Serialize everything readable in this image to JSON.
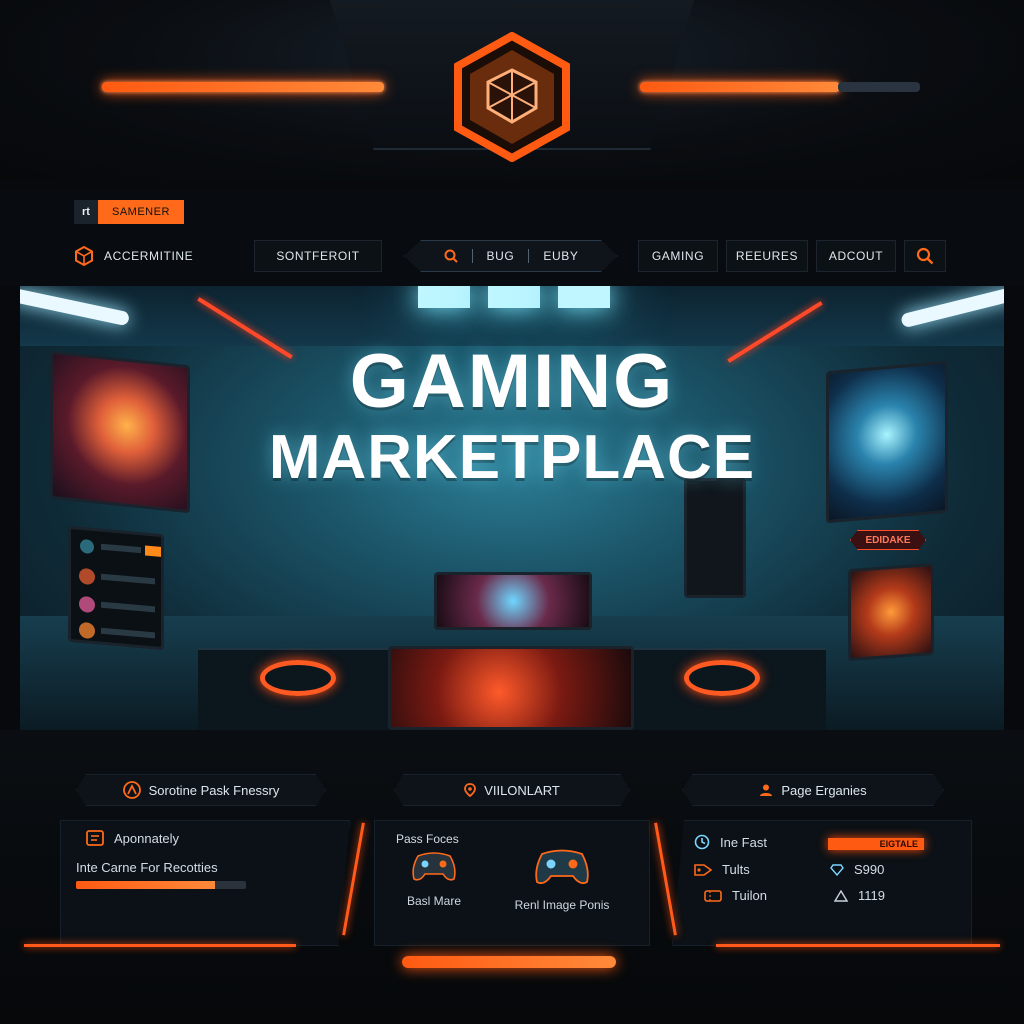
{
  "header": {
    "brand_tag_icon": "rt",
    "brand_tag_label": "SAMENER"
  },
  "nav": {
    "brand_label": "ACCERMITINE",
    "store_label": "SONTFEROIT",
    "search_group": {
      "item_1": "BUG",
      "item_2": "EUBY"
    },
    "gaming_label": "GAMING",
    "features_label": "REEURES",
    "account_label": "ADCOUT"
  },
  "hero": {
    "title_line_1": "GAMING",
    "title_line_2": "MARKETPLACE",
    "badge_label": "EDIDAKE"
  },
  "panels": {
    "left": {
      "heading": "Sorotine Pask Fnessry",
      "item_label": "Aponnately",
      "caption": "Inte Carne For Recotties",
      "progress": 0.82
    },
    "center": {
      "heading": "VIILONLART",
      "section_title": "Pass Foces",
      "pad_1_label": "Basl Mare",
      "pad_2_label": "Renl Image Ponis"
    },
    "right": {
      "heading": "Page Erganies",
      "row_1_label": "Ine Fast",
      "row_1_tag": "EIGTALE",
      "row_2_label": "Tults",
      "row_2_value": "S990",
      "row_3_label": "Tuilon",
      "row_3_value": "1119"
    }
  },
  "colors": {
    "accent": "#ff5a12",
    "background": "#07090c",
    "hero_teal": "#2c7f97"
  }
}
